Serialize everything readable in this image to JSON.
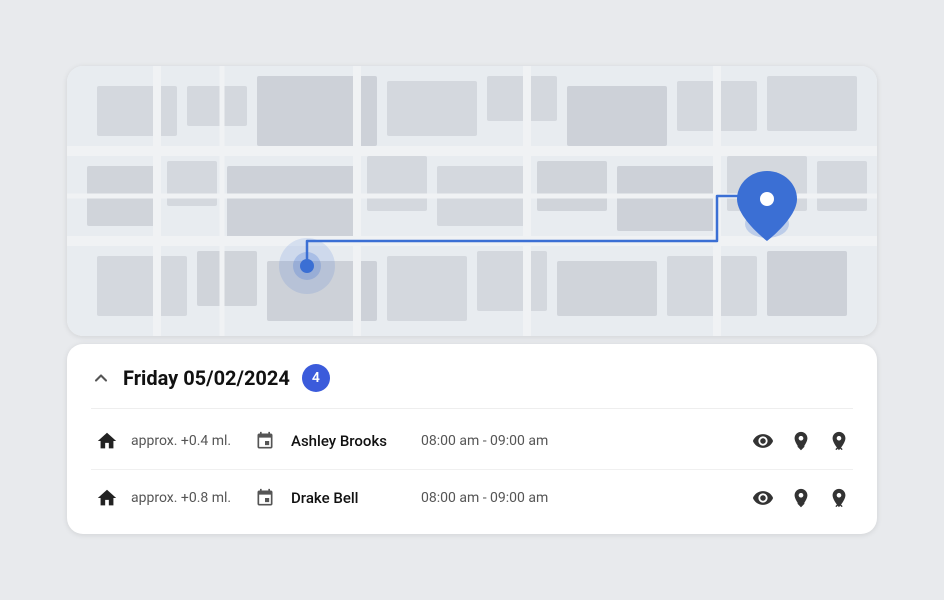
{
  "map": {
    "alt": "Map view showing route"
  },
  "date_section": {
    "chevron": "expand_less",
    "date_label": "Friday 05/02/2024",
    "count": "4"
  },
  "trips": [
    {
      "icon": "home",
      "distance": "approx. +0.4 ml.",
      "name": "Ashley Brooks",
      "time": "08:00 am - 09:00 am"
    },
    {
      "icon": "home",
      "distance": "approx. +0.8 ml.",
      "name": "Drake Bell",
      "time": "08:00 am - 09:00 am"
    }
  ],
  "actions": {
    "view_label": "view",
    "pickup_label": "pickup",
    "dropoff_label": "dropoff"
  }
}
